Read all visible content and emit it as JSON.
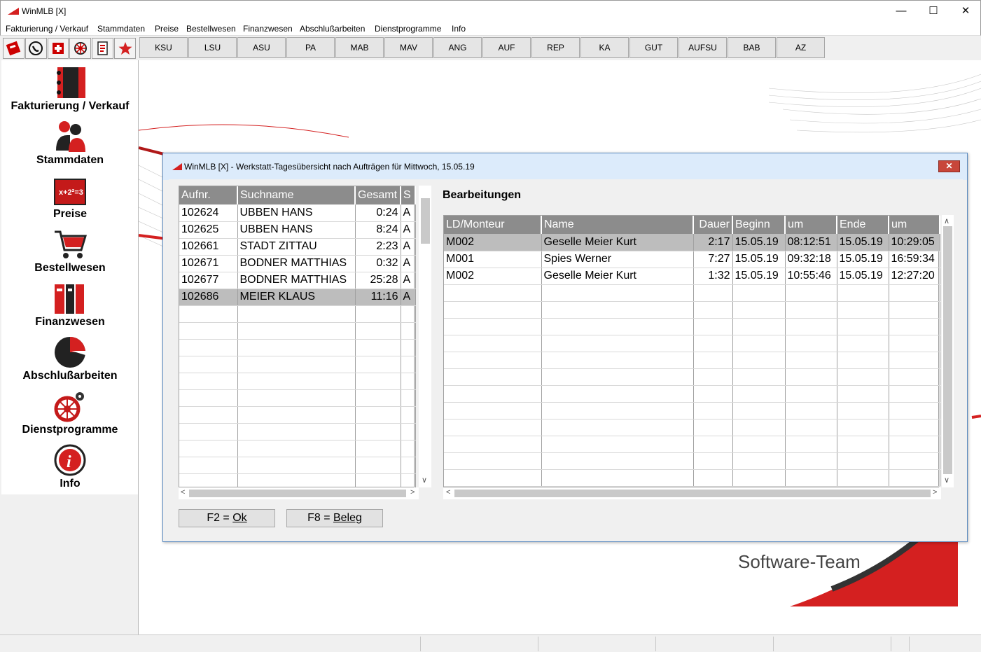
{
  "window": {
    "title": "WinMLB [X]",
    "controls": [
      "—",
      "☐",
      "✕"
    ]
  },
  "menu": [
    "Fakturierung / Verkauf",
    "Stammdaten",
    "Preise",
    "Bestellwesen",
    "Finanzwesen",
    "Abschlußarbeiten",
    "Dienstprogramme",
    "Info"
  ],
  "toolbar_icons": [
    "calculator-icon",
    "phone-icon",
    "first-aid-icon",
    "wheel-icon",
    "checklist-icon",
    "star-icon"
  ],
  "tabs": [
    "KSU",
    "LSU",
    "ASU",
    "PA",
    "MAB",
    "MAV",
    "ANG",
    "AUF",
    "REP",
    "KA",
    "GUT",
    "AUFSU",
    "BAB",
    "AZ"
  ],
  "sidebar": [
    {
      "label": "Fakturierung / Verkauf",
      "icon": "binder-icon"
    },
    {
      "label": "Stammdaten",
      "icon": "users-icon"
    },
    {
      "label": "Preise",
      "icon": "chalkboard-icon"
    },
    {
      "label": "Bestellwesen",
      "icon": "cart-icon"
    },
    {
      "label": "Finanzwesen",
      "icon": "books-icon"
    },
    {
      "label": "Abschlußarbeiten",
      "icon": "pie-chart-icon"
    },
    {
      "label": "Dienstprogramme",
      "icon": "gears-icon"
    },
    {
      "label": "Info",
      "icon": "info-icon"
    }
  ],
  "branding": {
    "text": "Software-Team",
    "accent": "#d42020"
  },
  "dialog": {
    "title": "WinMLB [X] - Werkstatt-Tagesübersicht nach Aufträgen für Mittwoch, 15.05.19",
    "close": "✕",
    "left_table": {
      "headers": [
        "Aufnr.",
        "Suchname",
        "Gesamt",
        "S"
      ],
      "rows": [
        [
          "102624",
          "UBBEN HANS",
          "0:24",
          "A"
        ],
        [
          "102625",
          "UBBEN HANS",
          "8:24",
          "A"
        ],
        [
          "102661",
          "STADT ZITTAU",
          "2:23",
          "A"
        ],
        [
          "102671",
          "BODNER MATTHIAS",
          "0:32",
          "A"
        ],
        [
          "102677",
          "BODNER MATTHIAS",
          "25:28",
          "A"
        ],
        [
          "102686",
          "MEIER KLAUS",
          "11:16",
          "A"
        ]
      ],
      "selected_row": 5,
      "empty_rows": 11
    },
    "section_title": "Bearbeitungen",
    "right_table": {
      "headers": [
        "LD/Monteur",
        "Name",
        "Dauer",
        "Beginn",
        "um",
        "Ende",
        "um"
      ],
      "rows": [
        [
          "M002",
          "Geselle Meier Kurt",
          "2:17",
          "15.05.19",
          "08:12:51",
          "15.05.19",
          "10:29:05"
        ],
        [
          "M001",
          "Spies Werner",
          "7:27",
          "15.05.19",
          "09:32:18",
          "15.05.19",
          "16:59:34"
        ],
        [
          "M002",
          "Geselle Meier Kurt",
          "1:32",
          "15.05.19",
          "10:55:46",
          "15.05.19",
          "12:27:20"
        ]
      ],
      "selected_row": 0,
      "empty_rows": 12
    },
    "buttons": {
      "ok_prefix": "F2 = ",
      "ok_key": "Ok",
      "beleg_prefix": "F8 = ",
      "beleg_key": "Beleg"
    }
  }
}
